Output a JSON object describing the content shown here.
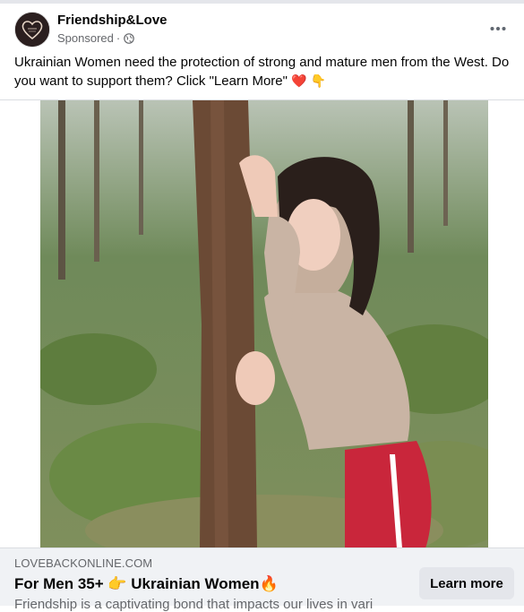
{
  "post": {
    "page_name": "Friendship&Love",
    "sponsored_label": "Sponsored",
    "separator": "·",
    "audience_icon": "globe-icon",
    "more_icon": "more-horizontal-icon",
    "text": "Ukrainian Women need the protection of strong and mature men from the West. Do you want to support them? Click \"Learn More\"",
    "text_emojis": "❤️ 👇"
  },
  "media": {
    "photo_alt": "Young woman in a beige hoodie and red track pants leaning against a pine tree in a forest"
  },
  "link_preview": {
    "domain": "LOVEBACKONLINE.COM",
    "headline": "For Men 35+ 👉 Ukrainian Women🔥",
    "description": "Friendship is a captivating bond that impacts our lives in vari",
    "cta_label": "Learn more"
  },
  "colors": {
    "primary_text": "#050505",
    "secondary_text": "#65676b",
    "link_bar_bg": "#f0f2f5",
    "button_bg": "#e4e6eb",
    "heart": "#e41e3f"
  }
}
